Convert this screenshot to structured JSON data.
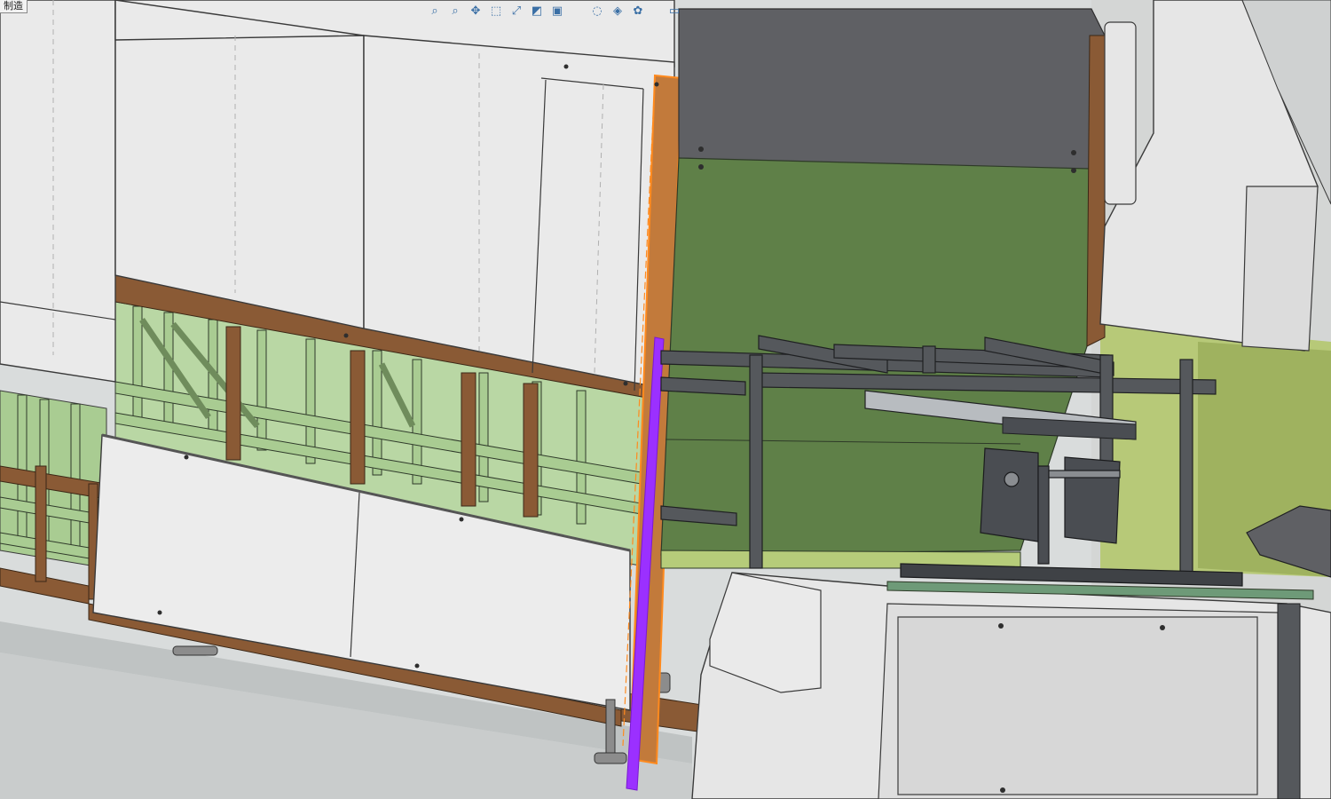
{
  "app": {
    "tab_label": "制造"
  },
  "toolbar": {
    "items": [
      {
        "name": "zoom-in-icon",
        "glyph": "⌕"
      },
      {
        "name": "zoom-out-icon",
        "glyph": "⌕"
      },
      {
        "name": "pan-icon",
        "glyph": "✥"
      },
      {
        "name": "normal-view-icon",
        "glyph": "⬚"
      },
      {
        "name": "fit-all-icon",
        "glyph": "⤢"
      },
      {
        "name": "iso-view-icon",
        "glyph": "◩"
      },
      {
        "name": "view-cube-icon",
        "glyph": "▣"
      },
      {
        "name": "hide-show-icon",
        "glyph": "◌"
      },
      {
        "name": "render-style-icon",
        "glyph": "◈"
      },
      {
        "name": "color-palette-icon",
        "glyph": "✿"
      },
      {
        "name": "display-monitor-icon",
        "glyph": "▭"
      }
    ]
  },
  "colors": {
    "background": "#d9dcdc",
    "panel": "#e9eae9",
    "panel_edge": "#3a3a3a",
    "frame_brown": "#8a5a35",
    "frame_green": "#a9cc92",
    "box_green": "#5f8048",
    "box_top_gray": "#5f6064",
    "rail_dark": "#55585c",
    "highlight_purple": "#9b30ff",
    "highlight_orange": "#ff8a1e",
    "machine_white": "#e6e6e6"
  }
}
